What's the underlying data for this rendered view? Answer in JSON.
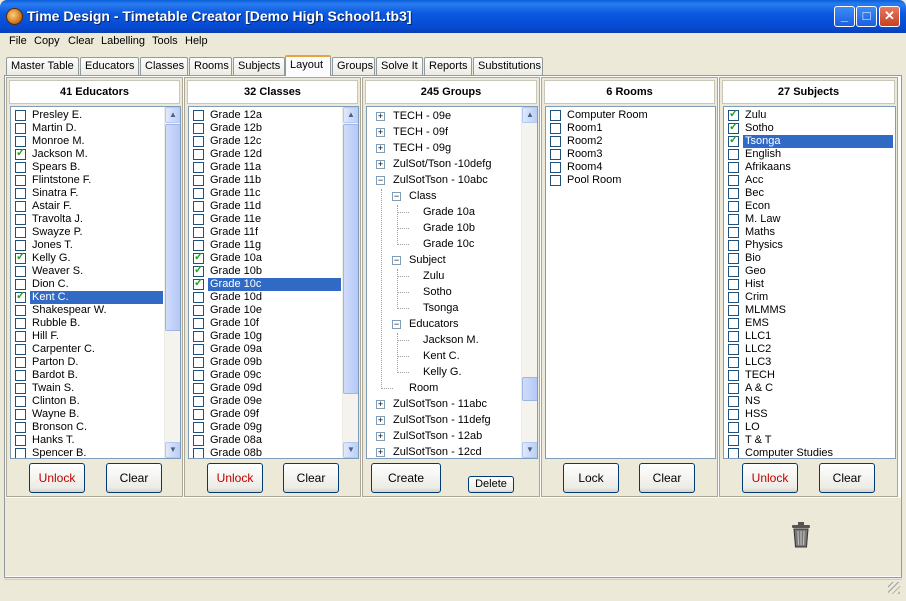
{
  "window": {
    "title": "Time Design - Timetable Creator [Demo High School1.tb3]"
  },
  "menu": [
    "File",
    "Copy",
    "Clear",
    "Labelling",
    "Tools",
    "Help"
  ],
  "tabs": [
    "Master Table",
    "Educators",
    "Classes",
    "Rooms",
    "Subjects",
    "Layout",
    "Groups",
    "Solve It",
    "Reports",
    "Substitutions"
  ],
  "active_tab": "Layout",
  "educators": {
    "header": "41 Educators",
    "items": [
      {
        "label": "Presley E.",
        "checked": false
      },
      {
        "label": "Martin D.",
        "checked": false
      },
      {
        "label": "Monroe M.",
        "checked": false
      },
      {
        "label": "Jackson M.",
        "checked": true
      },
      {
        "label": "Spears B.",
        "checked": false
      },
      {
        "label": "Flintstone F.",
        "checked": false
      },
      {
        "label": "Sinatra F.",
        "checked": false
      },
      {
        "label": "Astair F.",
        "checked": false
      },
      {
        "label": "Travolta J.",
        "checked": false
      },
      {
        "label": "Swayze P.",
        "checked": false
      },
      {
        "label": "Jones T.",
        "checked": false
      },
      {
        "label": "Kelly G.",
        "checked": true
      },
      {
        "label": "Weaver S.",
        "checked": false
      },
      {
        "label": "Dion C.",
        "checked": false
      },
      {
        "label": "Kent C.",
        "checked": true,
        "selected": true
      },
      {
        "label": "Shakespear W.",
        "checked": false
      },
      {
        "label": "Rubble B.",
        "checked": false
      },
      {
        "label": "Hill F.",
        "checked": false
      },
      {
        "label": "Carpenter C.",
        "checked": false
      },
      {
        "label": "Parton D.",
        "checked": false
      },
      {
        "label": "Bardot B.",
        "checked": false
      },
      {
        "label": "Twain S.",
        "checked": false
      },
      {
        "label": "Clinton B.",
        "checked": false
      },
      {
        "label": "Wayne B.",
        "checked": false
      },
      {
        "label": "Bronson C.",
        "checked": false
      },
      {
        "label": "Hanks T.",
        "checked": false
      },
      {
        "label": "Spencer B.",
        "checked": false
      }
    ],
    "buttons": {
      "unlock": "Unlock",
      "clear": "Clear"
    }
  },
  "classes": {
    "header": "32 Classes",
    "items": [
      {
        "label": "Grade 12a",
        "checked": false
      },
      {
        "label": "Grade 12b",
        "checked": false
      },
      {
        "label": "Grade 12c",
        "checked": false
      },
      {
        "label": "Grade 12d",
        "checked": false
      },
      {
        "label": "Grade 11a",
        "checked": false
      },
      {
        "label": "Grade 11b",
        "checked": false
      },
      {
        "label": "Grade 11c",
        "checked": false
      },
      {
        "label": "Grade 11d",
        "checked": false
      },
      {
        "label": "Grade 11e",
        "checked": false
      },
      {
        "label": "Grade 11f",
        "checked": false
      },
      {
        "label": "Grade 11g",
        "checked": false
      },
      {
        "label": "Grade 10a",
        "checked": true
      },
      {
        "label": "Grade 10b",
        "checked": true
      },
      {
        "label": "Grade 10c",
        "checked": true,
        "selected": true
      },
      {
        "label": "Grade 10d",
        "checked": false
      },
      {
        "label": "Grade 10e",
        "checked": false
      },
      {
        "label": "Grade 10f",
        "checked": false
      },
      {
        "label": "Grade 10g",
        "checked": false
      },
      {
        "label": "Grade 09a",
        "checked": false
      },
      {
        "label": "Grade 09b",
        "checked": false
      },
      {
        "label": "Grade 09c",
        "checked": false
      },
      {
        "label": "Grade 09d",
        "checked": false
      },
      {
        "label": "Grade 09e",
        "checked": false
      },
      {
        "label": "Grade 09f",
        "checked": false
      },
      {
        "label": "Grade 09g",
        "checked": false
      },
      {
        "label": "Grade 08a",
        "checked": false
      },
      {
        "label": "Grade 08b",
        "checked": false
      }
    ],
    "buttons": {
      "unlock": "Unlock",
      "clear": "Clear"
    }
  },
  "groups": {
    "header": "245 Groups",
    "tree": [
      {
        "label": "TECH - 09e",
        "level": 0,
        "expander": "+"
      },
      {
        "label": "TECH - 09f",
        "level": 0,
        "expander": "+"
      },
      {
        "label": "TECH - 09g",
        "level": 0,
        "expander": "+"
      },
      {
        "label": "ZulSot/Tson -10defg",
        "level": 0,
        "expander": "+"
      },
      {
        "label": "ZulSotTson - 10abc",
        "level": 0,
        "expander": "-"
      },
      {
        "label": "Class",
        "level": 1,
        "expander": "-"
      },
      {
        "label": "Grade 10a",
        "level": 2
      },
      {
        "label": "Grade 10b",
        "level": 2
      },
      {
        "label": "Grade 10c",
        "level": 2
      },
      {
        "label": "Subject",
        "level": 1,
        "expander": "-"
      },
      {
        "label": "Zulu",
        "level": 2
      },
      {
        "label": "Sotho",
        "level": 2
      },
      {
        "label": "Tsonga",
        "level": 2
      },
      {
        "label": "Educators",
        "level": 1,
        "expander": "-"
      },
      {
        "label": "Jackson M.",
        "level": 2
      },
      {
        "label": "Kent C.",
        "level": 2
      },
      {
        "label": "Kelly G.",
        "level": 2
      },
      {
        "label": "Room",
        "level": 1
      },
      {
        "label": "ZulSotTson - 11abc",
        "level": 0,
        "expander": "+"
      },
      {
        "label": "ZulSotTson - 11defg",
        "level": 0,
        "expander": "+"
      },
      {
        "label": "ZulSotTson - 12ab",
        "level": 0,
        "expander": "+"
      },
      {
        "label": "ZulSotTson - 12cd",
        "level": 0,
        "expander": "+"
      }
    ],
    "buttons": {
      "create": "Create",
      "delete": "Delete"
    }
  },
  "rooms": {
    "header": "6 Rooms",
    "items": [
      {
        "label": "Computer Room",
        "checked": false
      },
      {
        "label": "Room1",
        "checked": false
      },
      {
        "label": "Room2",
        "checked": false
      },
      {
        "label": "Room3",
        "checked": false
      },
      {
        "label": "Room4",
        "checked": false
      },
      {
        "label": "Pool Room",
        "checked": false
      }
    ],
    "buttons": {
      "lock": "Lock",
      "clear": "Clear"
    }
  },
  "subjects": {
    "header": "27 Subjects",
    "items": [
      {
        "label": "Zulu",
        "checked": true
      },
      {
        "label": "Sotho",
        "checked": true
      },
      {
        "label": "Tsonga",
        "checked": true,
        "selected": true
      },
      {
        "label": "English",
        "checked": false
      },
      {
        "label": "Afrikaans",
        "checked": false
      },
      {
        "label": "Acc",
        "checked": false
      },
      {
        "label": "Bec",
        "checked": false
      },
      {
        "label": "Econ",
        "checked": false
      },
      {
        "label": "M. Law",
        "checked": false
      },
      {
        "label": "Maths",
        "checked": false
      },
      {
        "label": "Physics",
        "checked": false
      },
      {
        "label": "Bio",
        "checked": false
      },
      {
        "label": "Geo",
        "checked": false
      },
      {
        "label": "Hist",
        "checked": false
      },
      {
        "label": "Crim",
        "checked": false
      },
      {
        "label": "MLMMS",
        "checked": false
      },
      {
        "label": "EMS",
        "checked": false
      },
      {
        "label": "LLC1",
        "checked": false
      },
      {
        "label": "LLC2",
        "checked": false
      },
      {
        "label": "LLC3",
        "checked": false
      },
      {
        "label": "TECH",
        "checked": false
      },
      {
        "label": "A & C",
        "checked": false
      },
      {
        "label": "NS",
        "checked": false
      },
      {
        "label": "HSS",
        "checked": false
      },
      {
        "label": "LO",
        "checked": false
      },
      {
        "label": "T & T",
        "checked": false
      },
      {
        "label": "Computer Studies",
        "checked": false
      }
    ],
    "buttons": {
      "unlock": "Unlock",
      "clear": "Clear"
    }
  },
  "icons": {
    "trash": "trash-icon",
    "app": "app-icon"
  }
}
